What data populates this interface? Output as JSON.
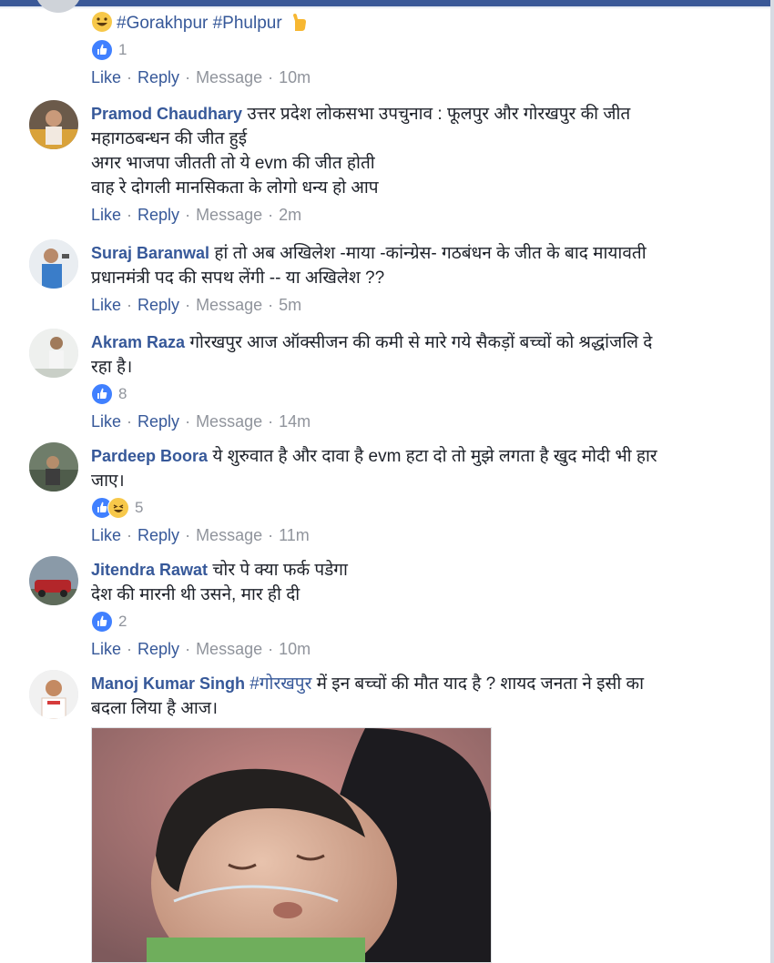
{
  "ui": {
    "like": "Like",
    "reply": "Reply",
    "message": "Message"
  },
  "comments": [
    {
      "text_lines": [
        "#Gorakhpur #Phulpur"
      ],
      "reaction_count": "1",
      "time": "10m"
    },
    {
      "author": "Pramod Chaudhary",
      "text_lines": [
        "उत्तर प्रदेश लोकसभा उपचुनाव : फूलपुर और गोरखपुर की जीत",
        "महागठबन्धन की जीत हुई",
        "अगर भाजपा जीतती तो ये evm की जीत होती",
        "वाह रे दोगली मानसिकता के लोगो धन्य हो आप"
      ],
      "time": "2m"
    },
    {
      "author": "Suraj Baranwal",
      "text_lines": [
        "हां तो अब अखिलेश -माया -कांन्ग्रेस- गठबंधन के जीत के बाद मायावती",
        "प्रधानमंत्री पद की सपथ लेंगी -- या अखिलेश ??"
      ],
      "time": "5m"
    },
    {
      "author": "Akram Raza",
      "text_lines": [
        "गोरखपुर आज ऑक्सीजन की कमी से मारे गये सैकड़ों बच्चों को श्रद्धांजलि दे",
        "रहा है।"
      ],
      "reaction_count": "8",
      "time": "14m"
    },
    {
      "author": "Pardeep Boora",
      "text_lines": [
        "ये शुरुवात है और दावा है evm हटा दो तो मुझे लगता है खुद मोदी भी हार",
        "जाए।"
      ],
      "reaction_count": "5",
      "time": "11m"
    },
    {
      "author": "Jitendra Rawat",
      "text_lines": [
        "चोर पे क्या फर्क पडेगा",
        "देश की मारनी थी उसने, मार ही दी"
      ],
      "reaction_count": "2",
      "time": "10m"
    },
    {
      "author": "Manoj Kumar Singh",
      "hashtag": "#गोरखपुर",
      "text_lines": [
        "में इन बच्चों की मौत याद है ? शायद जनता ने इसी का",
        "बदला लिया है आज।"
      ]
    }
  ],
  "colors": {
    "link": "#365899",
    "muted": "#90949c",
    "like_blue": "#4080ff",
    "header": "#3b5998"
  }
}
